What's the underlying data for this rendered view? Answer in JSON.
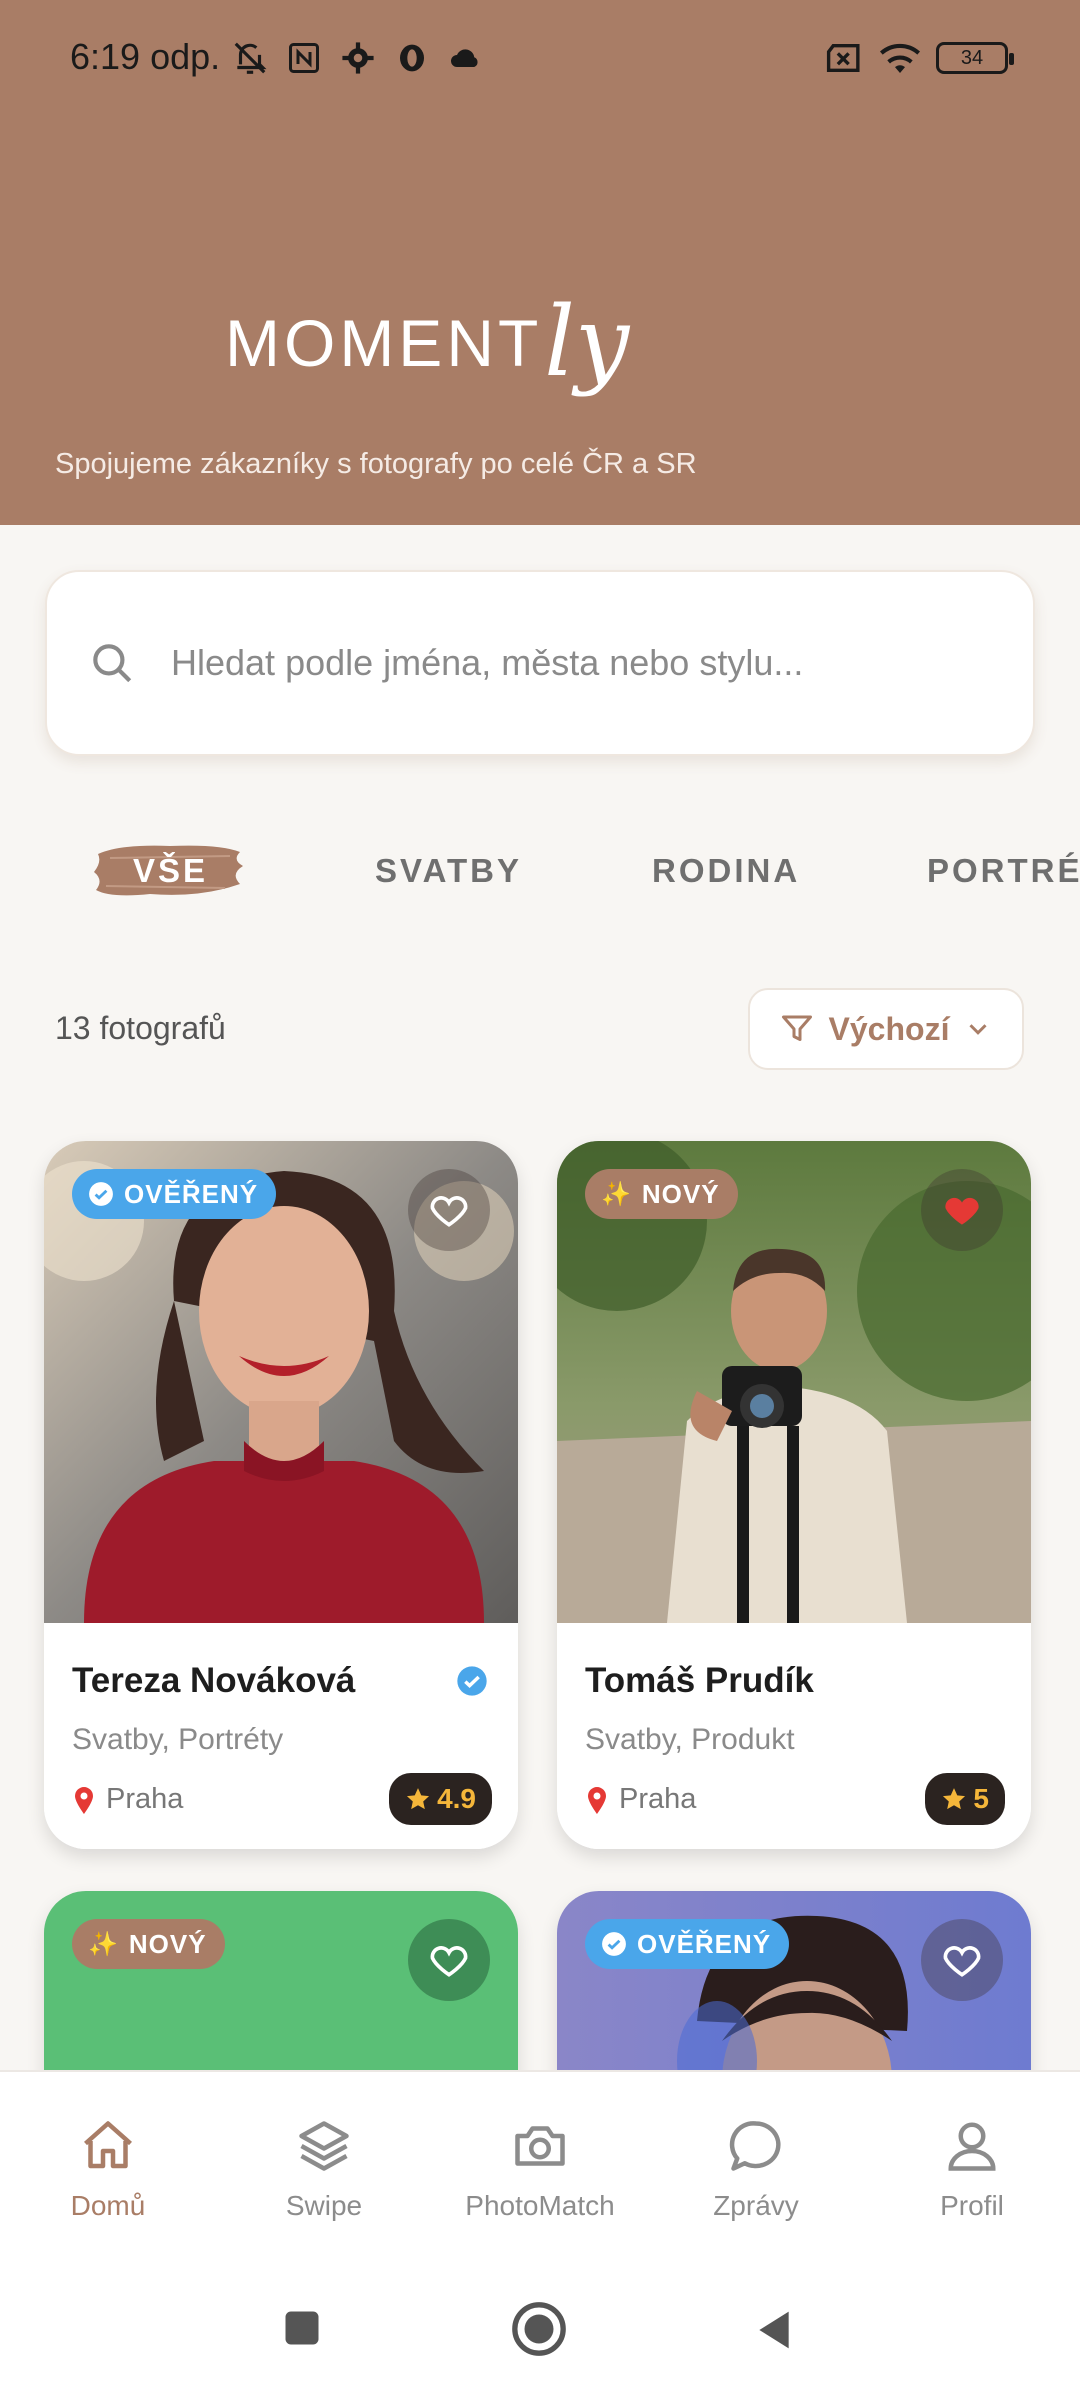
{
  "status_bar": {
    "time": "6:19 odp.",
    "battery": "34"
  },
  "header": {
    "logo_main": "MOMENT",
    "logo_script": "ly",
    "tagline": "Spojujeme zákazníky s fotografy po celé ČR a SR"
  },
  "search": {
    "placeholder": "Hledat podle jména, města nebo stylu..."
  },
  "tabs": [
    {
      "label": "VŠE",
      "active": true
    },
    {
      "label": "SVATBY",
      "active": false
    },
    {
      "label": "RODINA",
      "active": false
    },
    {
      "label": "PORTRÉTY",
      "active": false
    }
  ],
  "results": {
    "count": "13 fotografů",
    "sort_label": "Výchozí"
  },
  "cards": [
    {
      "badge": "OVĚŘENÝ",
      "badge_type": "verified",
      "favorited": false,
      "name": "Tereza Nováková",
      "verified_check": true,
      "styles": "Svatby, Portréty",
      "location": "Praha",
      "rating": "4.9"
    },
    {
      "badge": "NOVÝ",
      "badge_type": "new",
      "favorited": true,
      "name": "Tomáš Prudík",
      "verified_check": false,
      "styles": "Svatby, Produkt",
      "location": "Praha",
      "rating": "5"
    },
    {
      "badge": "NOVÝ",
      "badge_type": "new",
      "favorited": false
    },
    {
      "badge": "OVĚŘENÝ",
      "badge_type": "verified",
      "favorited": false
    }
  ],
  "bottom_nav": [
    {
      "label": "Domů",
      "icon": "home-icon",
      "active": true
    },
    {
      "label": "Swipe",
      "icon": "layers-icon",
      "active": false
    },
    {
      "label": "PhotoMatch",
      "icon": "camera-icon",
      "active": false
    },
    {
      "label": "Zprávy",
      "icon": "chat-icon",
      "active": false
    },
    {
      "label": "Profil",
      "icon": "user-icon",
      "active": false
    }
  ],
  "colors": {
    "brand": "#a97d66",
    "verified": "#4aa6ea",
    "rating_bg": "#2b2320",
    "star": "#f5b63a",
    "heart": "#e53935"
  }
}
